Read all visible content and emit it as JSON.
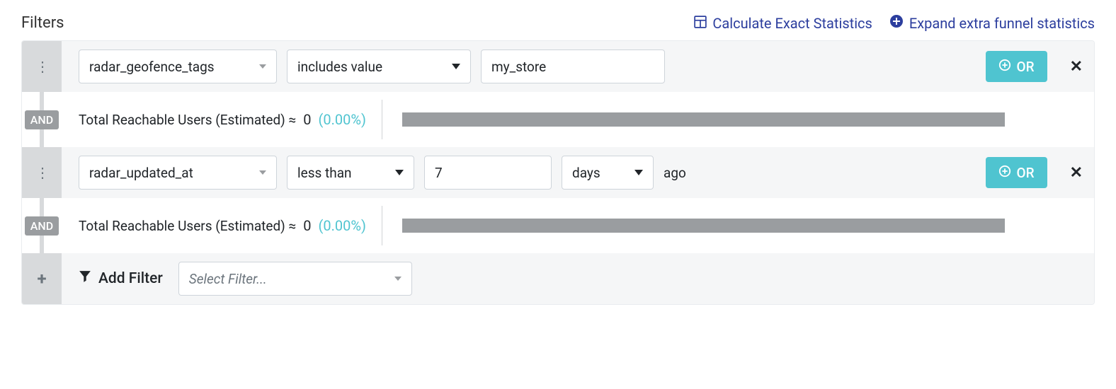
{
  "header": {
    "title": "Filters",
    "calc_link": "Calculate Exact Statistics",
    "expand_link": "Expand extra funnel statistics"
  },
  "rows": [
    {
      "field": "radar_geofence_tags",
      "operator": "includes value",
      "value": "my_store",
      "or_label": "OR"
    },
    {
      "field": "radar_updated_at",
      "operator": "less than",
      "number": "7",
      "unit": "days",
      "suffix": "ago",
      "or_label": "OR"
    }
  ],
  "stats": {
    "label": "Total Reachable Users (Estimated) ≈",
    "value": "0",
    "percent": "(0.00%)",
    "and_label": "AND"
  },
  "add": {
    "label": "Add Filter",
    "placeholder": "Select Filter..."
  }
}
